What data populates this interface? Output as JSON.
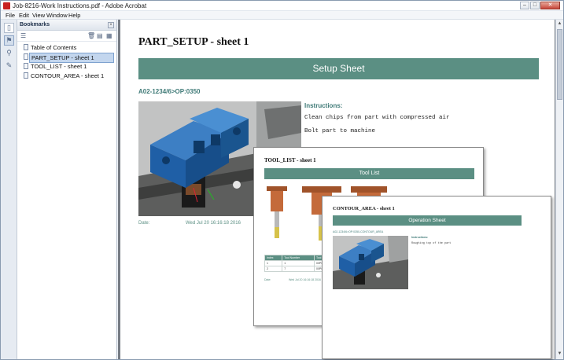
{
  "window": {
    "title": "Job-8216-Work Instructions.pdf - Adobe Acrobat",
    "min": "‒",
    "max": "□",
    "close": "✕"
  },
  "menu": [
    "File",
    "Edit",
    "View",
    "Window",
    "Help"
  ],
  "bookmarks": {
    "header": "Bookmarks",
    "close": "×",
    "items": [
      {
        "label": "Table of Contents",
        "selected": false
      },
      {
        "label": "PART_SETUP - sheet 1",
        "selected": true
      },
      {
        "label": "TOOL_LIST - sheet 1",
        "selected": false
      },
      {
        "label": "CONTOUR_AREA - sheet 1",
        "selected": false
      }
    ]
  },
  "page": {
    "title": "PART_SETUP - sheet 1",
    "banner": "Setup Sheet",
    "op_code": "A02-1234/6>OP:0350",
    "instructions_title": "Instructions:",
    "instructions": [
      "Clean chips from part with compressed air",
      "Bolt part to machine"
    ],
    "date_label": "Date:",
    "date_value": "Wed Jul 20 16:16:18 2016"
  },
  "tool_list": {
    "title": "TOOL_LIST - sheet 1",
    "banner": "Tool List",
    "headers": [
      "Index",
      "Tool Number",
      "Tool N..."
    ],
    "rows": [
      [
        "1",
        "1",
        "00P0000..."
      ],
      [
        "2",
        "7",
        "00P0000..."
      ]
    ],
    "date_label": "Date:",
    "date_value": "Wed Jul 20 16:16:18 2016"
  },
  "contour_area": {
    "title": "CONTOUR_AREA - sheet 1",
    "banner": "Operation Sheet",
    "op_code": "A02-1234/6>OP:0350-CONTOUR_AREA",
    "instructions_title": "Instructions:",
    "instruction": "Roughing top of the part"
  },
  "colors": {
    "accent": "#5b8f83",
    "part_blue": "#1f5fa6",
    "selected_bookmark": "#c3d6ee"
  },
  "icons": [
    "pdf-icon",
    "pages-icon",
    "attachment-icon",
    "signature-icon",
    "options-icon",
    "delete-icon",
    "new-bookmark-icon",
    "expand-icon",
    "bookmark-icon"
  ]
}
